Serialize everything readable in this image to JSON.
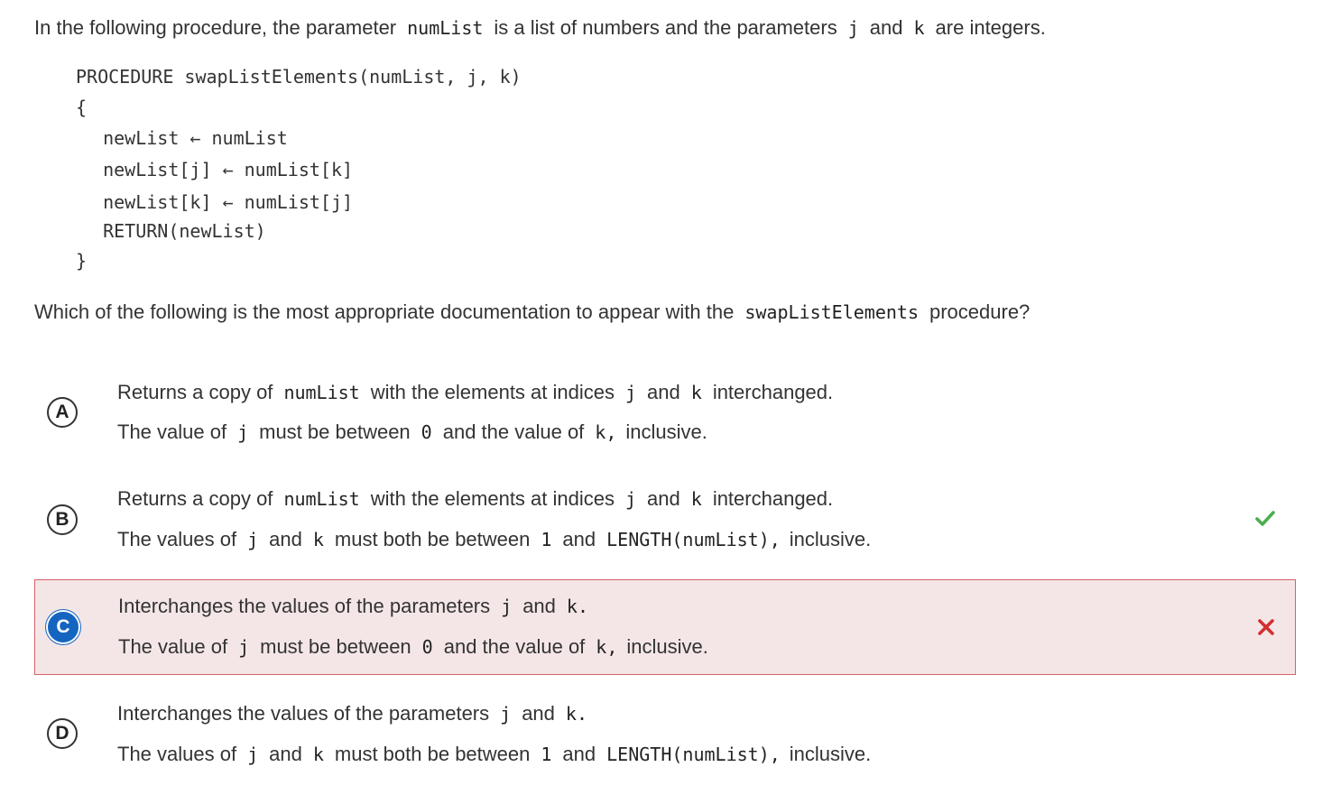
{
  "intro": {
    "t1": "In the following procedure, the parameter",
    "c1": "numList",
    "t2": "is a list of numbers and the parameters",
    "c2": "j",
    "t3": "and",
    "c3": "k",
    "t4": "are integers."
  },
  "code": {
    "line1": "PROCEDURE swapListElements(numList, j, k)",
    "line2": "{",
    "line3": "  newList ← numList",
    "line4": "  newList[j] ← numList[k]",
    "line5": "  newList[k] ← numList[j]",
    "line6": "  RETURN(newList)",
    "line7": "}"
  },
  "question": {
    "t1": "Which of the following is the most appropriate documentation to appear with the",
    "c1": "swapListElements",
    "t2": "procedure?"
  },
  "options": [
    {
      "letter": "A",
      "l1": [
        "Returns a copy of",
        "numList",
        "with the elements at indices",
        "j",
        "and",
        "k",
        "interchanged."
      ],
      "l2": [
        "The value of",
        "j",
        "must be between",
        "0",
        "and the value of",
        "k,",
        "inclusive."
      ]
    },
    {
      "letter": "B",
      "l1": [
        "Returns a copy of",
        "numList",
        "with the elements at indices",
        "j",
        "and",
        "k",
        "interchanged."
      ],
      "l2": [
        "The values of",
        "j",
        "and",
        "k",
        "must both be between",
        "1",
        "and",
        "LENGTH(numList),",
        "inclusive."
      ]
    },
    {
      "letter": "C",
      "l1": [
        "Interchanges the values of the parameters",
        "j",
        "and",
        "k."
      ],
      "l2": [
        "The value of",
        "j",
        "must be between",
        "0",
        "and the value of",
        "k,",
        "inclusive."
      ]
    },
    {
      "letter": "D",
      "l1": [
        "Interchanges the values of the parameters",
        "j",
        "and",
        "k."
      ],
      "l2": [
        "The values of",
        "j",
        "and",
        "k",
        "must both be between",
        "1",
        "and",
        "LENGTH(numList),",
        "inclusive."
      ]
    }
  ],
  "marks": {
    "correct_icon": "check-icon",
    "wrong_icon": "x-icon",
    "correct_color": "#4caf50",
    "wrong_color": "#d32f2f",
    "selected_bg": "#f4e6e7",
    "selected_border": "#d2606a",
    "selected_badge": "#1565c0"
  }
}
